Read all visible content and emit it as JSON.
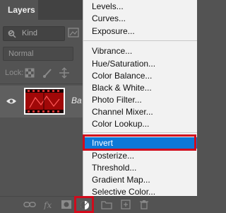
{
  "panel": {
    "tab_label": "Layers",
    "kind_label": "Kind",
    "blend_mode": "Normal",
    "lock_label": "Lock:",
    "layer_name": "Ba",
    "colors": {
      "accent": "#0c78d7",
      "annotation": "#d10b1c"
    }
  },
  "menu": {
    "items": [
      "Levels...",
      "Curves...",
      "Exposure...",
      "Vibrance...",
      "Hue/Saturation...",
      "Color Balance...",
      "Black & White...",
      "Photo Filter...",
      "Channel Mixer...",
      "Color Lookup...",
      "Invert",
      "Posterize...",
      "Threshold...",
      "Gradient Map...",
      "Selective Color..."
    ],
    "selected": "Invert"
  },
  "bottom_bar_icons": [
    "link-icon",
    "fx-icon",
    "mask-icon",
    "adjustment-layer-icon",
    "folder-icon",
    "new-layer-icon",
    "trash-icon"
  ]
}
